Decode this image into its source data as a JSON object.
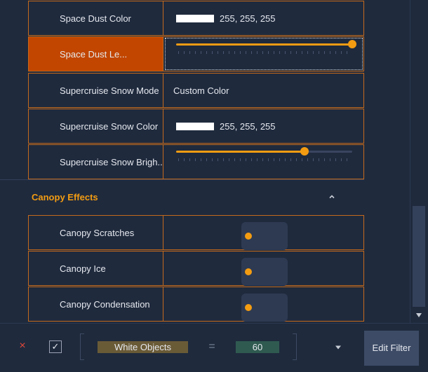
{
  "settings": [
    {
      "label": "Space Dust Color",
      "type": "color",
      "value": "255, 255, 255"
    },
    {
      "label": "Space Dust Le...",
      "type": "slider",
      "level_percent": 100,
      "selected": true
    },
    {
      "label": "Supercruise Snow Mode",
      "type": "text",
      "value": "Custom Color"
    },
    {
      "label": "Supercruise Snow Color",
      "type": "color",
      "value": "255, 255, 255"
    },
    {
      "label": "Supercruise Snow Brigh...",
      "type": "slider",
      "level_percent": 73
    }
  ],
  "section": {
    "title": "Canopy Effects",
    "icon": "chevron-up-icon"
  },
  "toggles": [
    {
      "label": "Canopy Scratches",
      "on": false
    },
    {
      "label": "Canopy Ice",
      "on": false
    },
    {
      "label": "Canopy Condensation",
      "on": false
    }
  ],
  "filter": {
    "remove_icon": "close-icon",
    "remove_symbol": "×",
    "enable_symbol": "✓",
    "enabled": true,
    "field": "White Objects",
    "operator": "=",
    "value": "60",
    "dropdown_icon": "chevron-down-icon",
    "edit_label": "Edit Filter"
  },
  "colors": {
    "accent": "#f39c12",
    "selected_row": "#c24600",
    "background": "#1f2a3d",
    "border": "#c46a1c"
  }
}
